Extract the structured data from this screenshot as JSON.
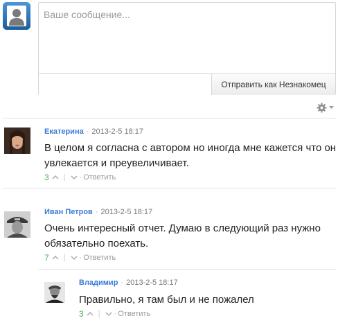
{
  "compose": {
    "placeholder": "Ваше сообщение...",
    "send_label": "Отправить как Незнакомец"
  },
  "icons": {
    "self_avatar": "user-silhouette-icon",
    "settings": "gear-icon",
    "upvote": "chevron-up-icon",
    "downvote": "chevron-down-icon"
  },
  "colors": {
    "author": "#3a7bd5",
    "votes": "#4caf50",
    "avatar_bg": "#2e6db4"
  },
  "comments": [
    {
      "author": "Екатерина",
      "date": "2013-2-5 18:17",
      "text": "В целом я согласна с автором но иногда мне кажется что он увлекается и преувеличивает.",
      "votes": "3",
      "reply_label": "Ответить"
    },
    {
      "author": "Иван Петров",
      "date": "2013-2-5 18:17",
      "text": "Очень интересный отчет. Думаю в следующий раз нужно обязательно поехать.",
      "votes": "7",
      "reply_label": "Ответить"
    },
    {
      "author": "Владимир",
      "date": "2013-2-5 18:17",
      "text": "Правильно, я там был и не пожалел",
      "votes": "3",
      "reply_label": "Ответить"
    }
  ]
}
